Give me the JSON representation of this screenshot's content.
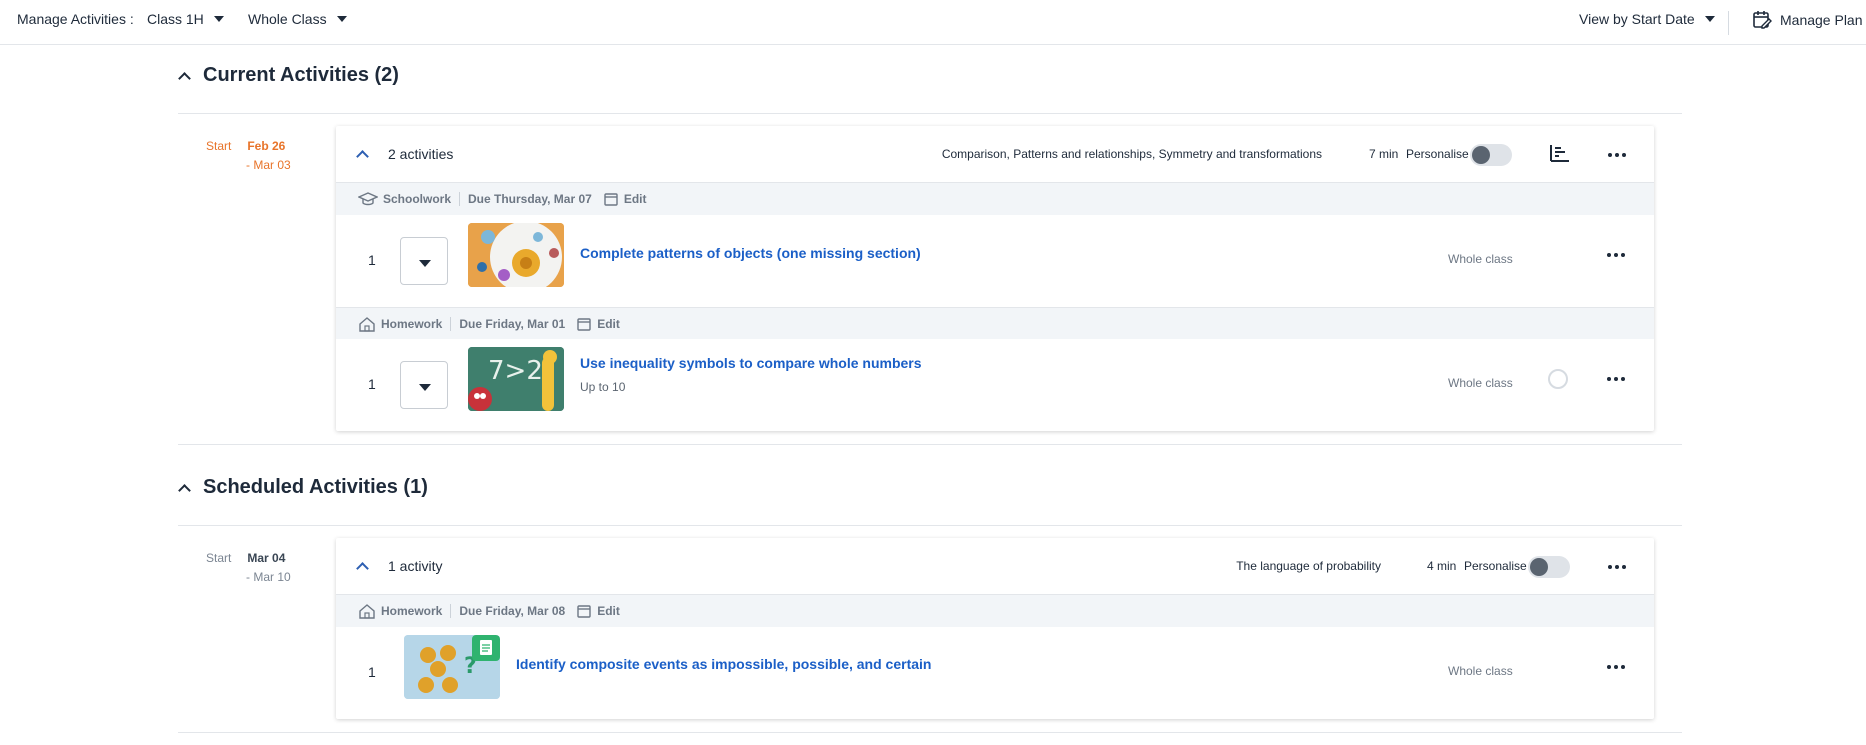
{
  "topbar": {
    "label": "Manage Activities :",
    "class_select": "Class 1H",
    "group_select": "Whole Class",
    "view_select": "View by Start Date",
    "manage_plan": "Manage Plan"
  },
  "current": {
    "title": "Current Activities (2)",
    "start_label": "Start",
    "start_date": "Feb 26",
    "end_date": "- Mar 03",
    "card": {
      "count": "2 activities",
      "topics": "Comparison, Patterns and relationships, Symmetry and transformations",
      "minutes": "7 min",
      "personalise": "Personalise",
      "groups": [
        {
          "type": "Schoolwork",
          "due": "Due Thursday, Mar 07",
          "edit": "Edit",
          "rows": [
            {
              "num": "1",
              "title": "Complete patterns of objects (one missing section)",
              "subtitle": "",
              "assign": "Whole class"
            }
          ]
        },
        {
          "type": "Homework",
          "due": "Due Friday, Mar 01",
          "edit": "Edit",
          "rows": [
            {
              "num": "1",
              "title": "Use inequality symbols to compare whole numbers",
              "subtitle": "Up to 10",
              "assign": "Whole class"
            }
          ]
        }
      ]
    }
  },
  "scheduled": {
    "title": "Scheduled Activities (1)",
    "start_label": "Start",
    "start_date": "Mar 04",
    "end_date": "- Mar 10",
    "card": {
      "count": "1 activity",
      "topics": "The language of probability",
      "minutes": "4 min",
      "personalise": "Personalise",
      "groups": [
        {
          "type": "Homework",
          "due": "Due Friday, Mar 08",
          "edit": "Edit",
          "rows": [
            {
              "num": "1",
              "title": "Identify composite events as impossible, possible, and certain",
              "assign": "Whole class"
            }
          ]
        }
      ]
    }
  },
  "thumb2_text": "7>2",
  "icons": [
    "caret-down-icon",
    "manage-plan-icon",
    "chevron-up-icon",
    "graduation-cap-icon",
    "home-icon",
    "calendar-icon",
    "bar-chart-icon",
    "more-icon",
    "worksheet-icon"
  ]
}
